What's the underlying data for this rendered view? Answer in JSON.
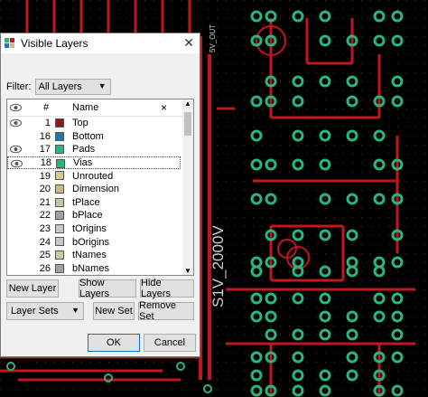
{
  "dialog": {
    "title": "Visible Layers",
    "filter_label": "Filter:",
    "filter_value": "All Layers",
    "columns": {
      "num": "#",
      "name": "Name",
      "x": "×"
    },
    "layers": [
      {
        "num": "1",
        "name": "Top",
        "color": "#8b1a1a",
        "visible": true
      },
      {
        "num": "16",
        "name": "Bottom",
        "color": "#1f77b4",
        "visible": false
      },
      {
        "num": "17",
        "name": "Pads",
        "color": "#2db37e",
        "visible": true
      },
      {
        "num": "18",
        "name": "Vias",
        "color": "#2db37e",
        "visible": true
      },
      {
        "num": "19",
        "name": "Unrouted",
        "color": "#d9c98a",
        "visible": false
      },
      {
        "num": "20",
        "name": "Dimension",
        "color": "#c8b88a",
        "visible": false
      },
      {
        "num": "21",
        "name": "tPlace",
        "color": "#c8c8a0",
        "visible": false
      },
      {
        "num": "22",
        "name": "bPlace",
        "color": "#a0a0a0",
        "visible": false
      },
      {
        "num": "23",
        "name": "tOrigins",
        "color": "#c8c8c8",
        "visible": false
      },
      {
        "num": "24",
        "name": "bOrigins",
        "color": "#c8c8c8",
        "visible": false
      },
      {
        "num": "25",
        "name": "tNames",
        "color": "#c8c8a0",
        "visible": false
      },
      {
        "num": "26",
        "name": "bNames",
        "color": "#a0a0a0",
        "visible": false
      }
    ],
    "buttons": {
      "new_layer": "New Layer",
      "show_layers": "Show Layers",
      "hide_layers": "Hide Layers",
      "layer_sets": "Layer Sets",
      "new_set": "New Set",
      "remove_set": "Remove Set",
      "ok": "OK",
      "cancel": "Cancel"
    }
  },
  "board": {
    "vertical_label": "S1V_2000V",
    "top_label": "5V_OUT",
    "colors": {
      "trace": "#c0161e",
      "pad": "#2db37e",
      "grid": "#1e1e1e"
    }
  }
}
